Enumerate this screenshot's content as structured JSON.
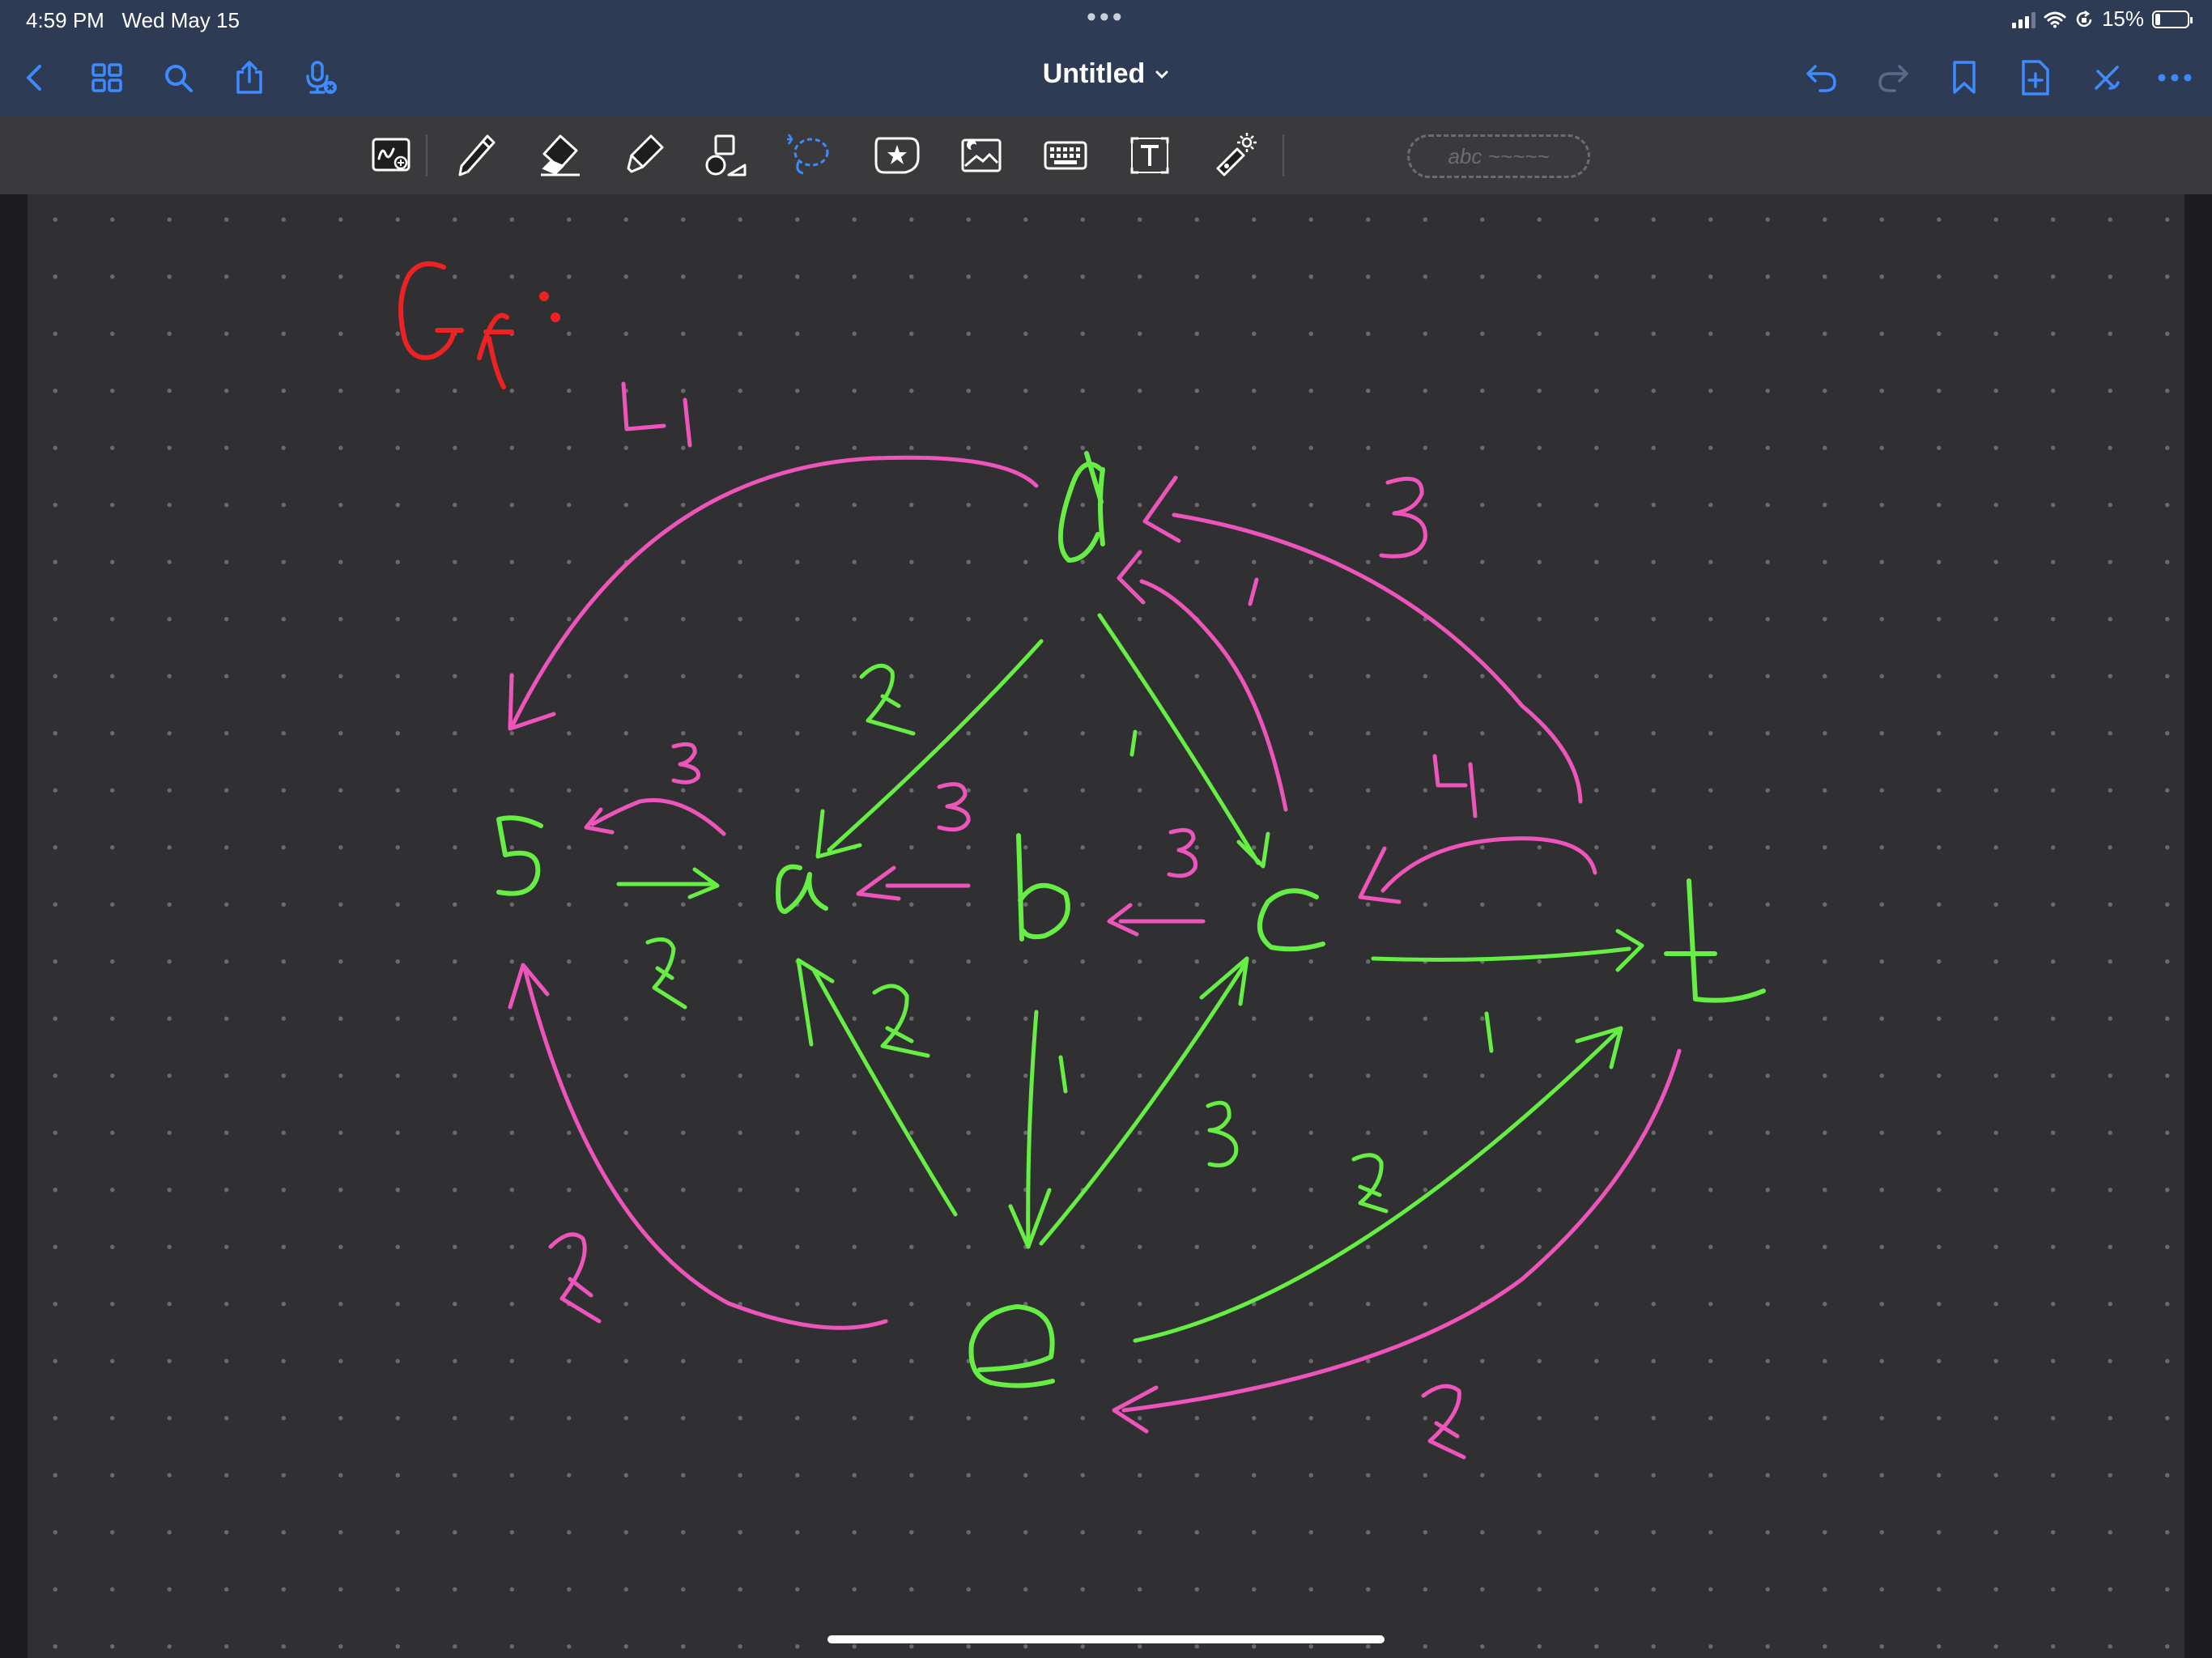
{
  "status_bar": {
    "time": "4:59 PM",
    "date": "Wed May 15",
    "battery_percent_label": "15%",
    "battery_level": 0.15
  },
  "nav": {
    "title": "Untitled",
    "left_icons": [
      "back-chevron-icon",
      "grid-icon",
      "search-icon",
      "share-icon",
      "microphone-icon"
    ],
    "right_icons": [
      "undo-icon",
      "redo-icon",
      "bookmark-icon",
      "add-page-icon",
      "close-icon",
      "more-icon"
    ]
  },
  "toolbar": {
    "tools": [
      "zoom-window-icon",
      "pen-icon",
      "eraser-icon",
      "highlighter-icon",
      "shapes-icon",
      "lasso-icon",
      "sticker-icon",
      "image-icon",
      "keyboard-icon",
      "text-box-icon",
      "laser-pointer-icon"
    ],
    "text_pill_placeholder": "abc ~~~~~"
  },
  "colors": {
    "chrome": "#2e3b55",
    "accent_blue": "#3d8bff",
    "toolbar": "#3a3a3c",
    "canvas": "#303032",
    "ink_green": "#66ee44",
    "ink_pink": "#ee55bb",
    "ink_red": "#ee2222"
  },
  "handwriting": {
    "heading": "Gf :",
    "nodes": [
      "s",
      "a",
      "b",
      "c",
      "d",
      "e",
      "t"
    ],
    "edge_weights": [
      "4",
      "3",
      "1",
      "2",
      "1",
      "3",
      "3",
      "3",
      "4",
      "2",
      "2",
      "1",
      "3",
      "2",
      "1",
      "2",
      "2"
    ]
  }
}
